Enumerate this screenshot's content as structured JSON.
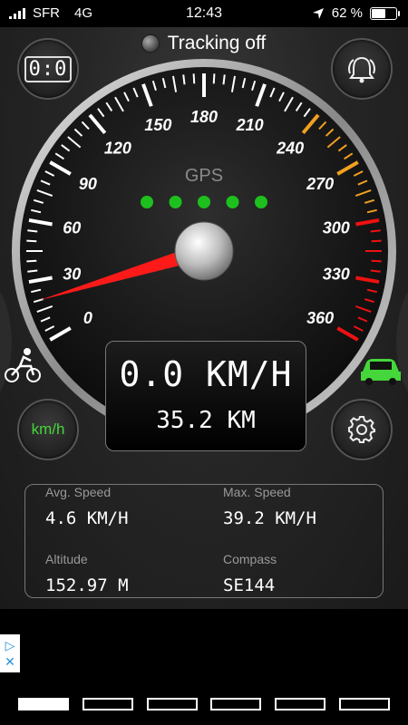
{
  "status_bar": {
    "carrier": "SFR",
    "network": "4G",
    "time": "12:43",
    "battery_text": "62 %",
    "battery_level": 0.62
  },
  "tracking": {
    "label": "Tracking off"
  },
  "buttons": {
    "timer_label": "0:0",
    "unit_label": "km/h"
  },
  "gauge": {
    "center_label": "GPS",
    "ticks": [
      "0",
      "30",
      "60",
      "90",
      "120",
      "150",
      "180",
      "210",
      "240",
      "270",
      "300",
      "330",
      "360"
    ],
    "max": 360,
    "value": 20,
    "warning_color": "#f0a020",
    "danger_color": "#ee1111",
    "needle_color": "#ff1a1a",
    "indicator_color": "#1ec01e",
    "indicator_count": 5
  },
  "display": {
    "speed": "0.0 KM/H",
    "distance": "35.2 KM"
  },
  "stats": [
    {
      "label": "Avg. Speed",
      "value": "4.6 KM/H"
    },
    {
      "label": "Max. Speed",
      "value": "39.2 KM/H"
    },
    {
      "label": "Altitude",
      "value": "152.97 M"
    },
    {
      "label": "Compass",
      "value": "SE144"
    }
  ],
  "modes": {
    "active_color": "#45d63b"
  },
  "pager": {
    "count": 6,
    "active": 0
  }
}
